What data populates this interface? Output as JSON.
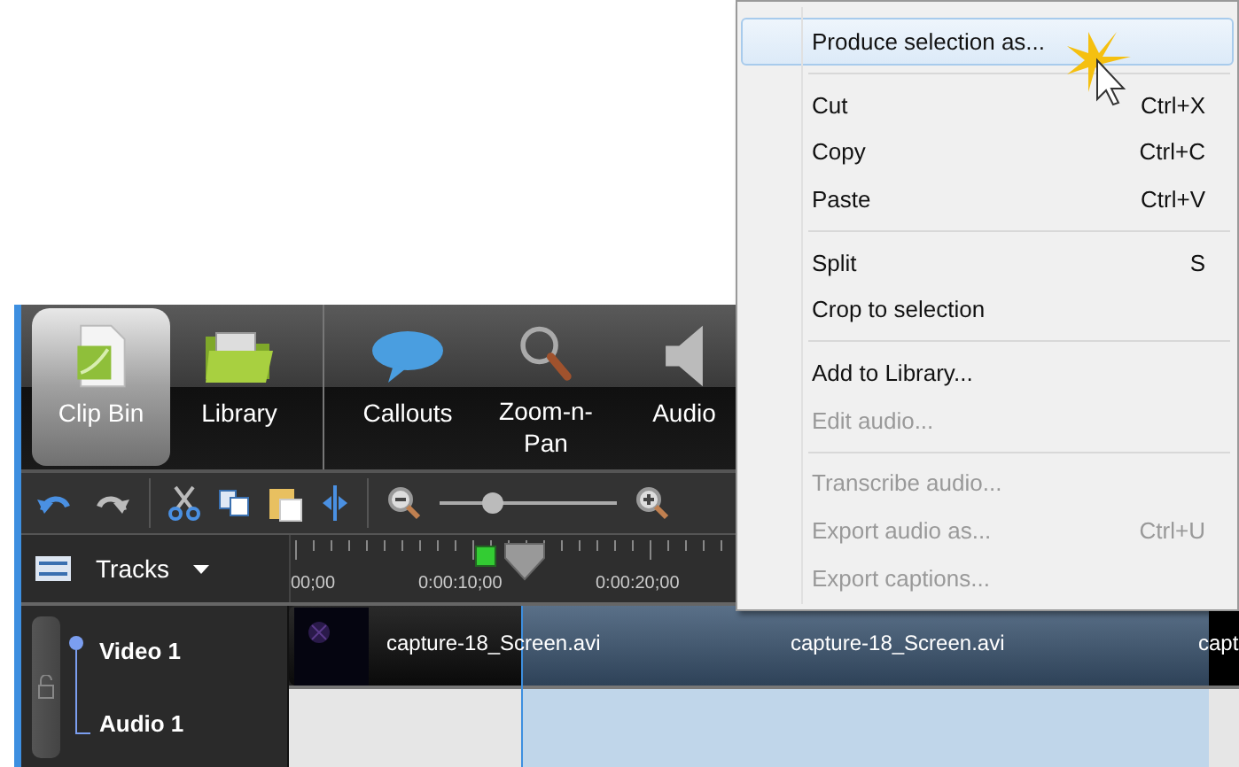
{
  "panel_tabs": [
    {
      "label": "Clip Bin",
      "selected": true
    },
    {
      "label": "Library",
      "selected": false
    },
    {
      "label": "Callouts",
      "selected": false
    },
    {
      "label": "Zoom-n-Pan",
      "selected": false
    },
    {
      "label": "Audio",
      "selected": false
    }
  ],
  "toolbar": {
    "zoom_slider": {
      "level": 0.3
    }
  },
  "ruler": {
    "header": "Tracks",
    "labels": [
      "00;00",
      "0:00:10;00",
      "0:00:20;00"
    ]
  },
  "tracks": [
    {
      "name": "Video 1"
    },
    {
      "name": "Audio 1"
    }
  ],
  "clips": [
    {
      "label": "capture-18_Screen.avi"
    },
    {
      "label": "capture-18_Screen.avi"
    },
    {
      "label": "capt"
    }
  ],
  "context_menu": [
    {
      "kind": "item",
      "label": "Produce selection as...",
      "selected": true,
      "disabled": false
    },
    {
      "kind": "separator"
    },
    {
      "kind": "item",
      "label": "Cut",
      "shortcut": "Ctrl+X",
      "selected": false,
      "disabled": false
    },
    {
      "kind": "item",
      "label": "Copy",
      "shortcut": "Ctrl+C",
      "selected": false,
      "disabled": false
    },
    {
      "kind": "item",
      "label": "Paste",
      "shortcut": "Ctrl+V",
      "selected": false,
      "disabled": false
    },
    {
      "kind": "separator"
    },
    {
      "kind": "item",
      "label": "Split",
      "shortcut": "S",
      "selected": false,
      "disabled": false
    },
    {
      "kind": "item",
      "label": "Crop to selection",
      "selected": false,
      "disabled": false
    },
    {
      "kind": "separator"
    },
    {
      "kind": "item",
      "label": "Add to Library...",
      "selected": false,
      "disabled": false
    },
    {
      "kind": "item",
      "label": "Edit audio...",
      "selected": false,
      "disabled": true
    },
    {
      "kind": "separator"
    },
    {
      "kind": "item",
      "label": "Transcribe audio...",
      "selected": false,
      "disabled": true
    },
    {
      "kind": "item",
      "label": "Export audio as...",
      "shortcut": "Ctrl+U",
      "selected": false,
      "disabled": true
    },
    {
      "kind": "item",
      "label": "Export captions...",
      "selected": false,
      "disabled": true
    }
  ]
}
